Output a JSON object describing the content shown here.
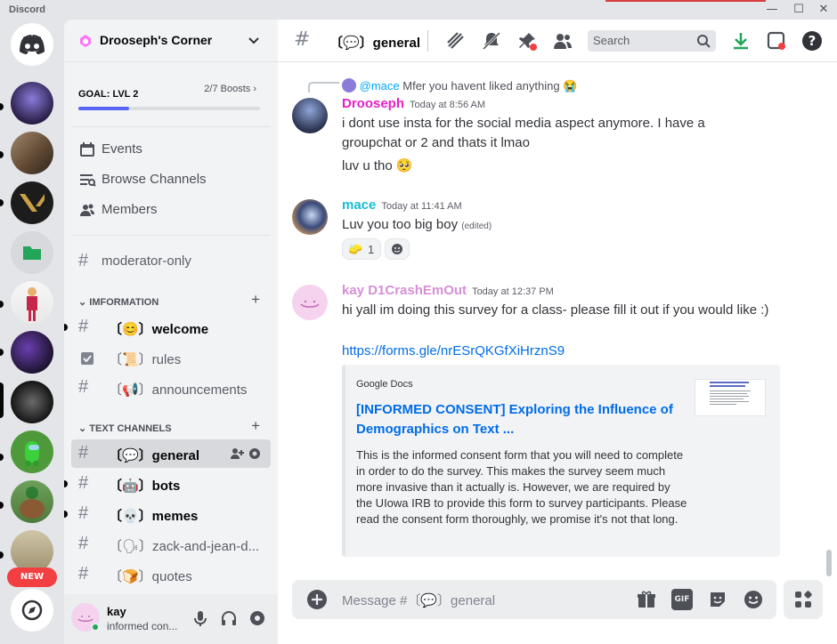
{
  "app": {
    "title": "Discord"
  },
  "window": {
    "minimize": "—",
    "maximize": "☐",
    "close": "✕"
  },
  "rail": {
    "new_badge": "NEW"
  },
  "server": {
    "name": "Drooseph's Corner",
    "boost_goal": "GOAL: LVL 2",
    "boost_count": "2/7 Boosts",
    "boost_progress": 0.28
  },
  "nav": [
    {
      "label": "Events",
      "icon": "calendar-icon"
    },
    {
      "label": "Browse Channels",
      "icon": "browse-channels-icon"
    },
    {
      "label": "Members",
      "icon": "members-icon"
    }
  ],
  "pinned_channel": {
    "label": "moderator-only"
  },
  "categories": [
    {
      "name": "IMFORMATION",
      "channels": [
        {
          "label": "〔😊〕welcome",
          "unread": true,
          "icon": "hash"
        },
        {
          "label": "〔📜〕rules",
          "unread": false,
          "icon": "rules-icon"
        },
        {
          "label": "〔📢〕announcements",
          "unread": false,
          "icon": "hash"
        }
      ]
    },
    {
      "name": "TEXT CHANNELS",
      "channels": [
        {
          "label": "〔💬〕general",
          "selected": true,
          "icon": "hash"
        },
        {
          "label": "〔🤖〕bots",
          "unread": true,
          "icon": "hash"
        },
        {
          "label": "〔💀〕memes",
          "unread": true,
          "icon": "hash"
        },
        {
          "label": "〔🗣〕zack-and-jean-d...",
          "unread": false,
          "icon": "hash"
        },
        {
          "label": "〔🍞〕quotes",
          "unread": false,
          "icon": "hash"
        }
      ]
    }
  ],
  "user": {
    "name": "kay",
    "status": "informed con..."
  },
  "header": {
    "channel": "〔💬〕general",
    "search_placeholder": "Search"
  },
  "messages": [
    {
      "reply_mention": "@mace",
      "reply_text": "Mfer you havent liked anything 😭",
      "author": "Drooseph",
      "author_color": "#e91ec7",
      "timestamp": "Today at 8:56 AM",
      "text": "i dont use insta for the social media aspect anymore. I have a groupchat or 2 and thats it lmao",
      "text2": "luv u tho 🥺"
    },
    {
      "author": "mace",
      "author_color": "#1abcd6",
      "timestamp": "Today at 11:41 AM",
      "text": "Luv you too big boy",
      "edited": "(edited)",
      "reactions": [
        {
          "emoji": "🧽",
          "count": "1"
        }
      ]
    },
    {
      "author": "kay D1CrashEmOut",
      "author_color": "#d68fd6",
      "timestamp": "Today at 12:37 PM",
      "text": "hi yall im doing this survey for a class- please fill it out if you would like :)",
      "link": "https://forms.gle/nrESrQKGfXiHrznS9",
      "embed": {
        "provider": "Google Docs",
        "title": "[INFORMED CONSENT] Exploring the Influence of Demographics on Text ...",
        "description": "This is the informed consent form that you will need to complete in order to do the survey. This makes the survey seem much more invasive than it actually is. However, we are required by the UIowa IRB to provide this form to survey participants. Please read the consent form thoroughly, we promise it's not that long."
      }
    }
  ],
  "composer": {
    "placeholder": "Message #〔💬〕general",
    "gif_label": "GIF"
  },
  "colors": {
    "accent": "#5865f2",
    "link": "#006ce7",
    "mention": "#00a8fc",
    "online": "#23a55a"
  }
}
